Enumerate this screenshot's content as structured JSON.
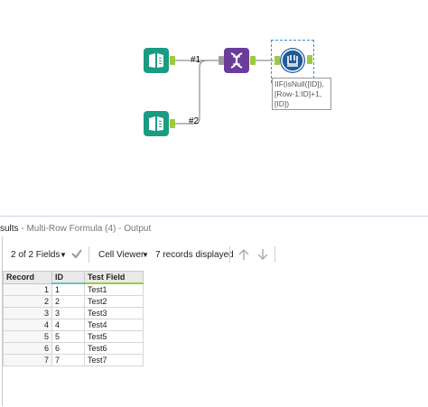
{
  "workflow": {
    "connection_labels": [
      "#1",
      "#2"
    ],
    "formula_annotation": [
      "IIF(isNull([ID]),",
      "[Row-1:ID]+1,",
      "[ID])"
    ]
  },
  "results": {
    "title_prefix": "sults",
    "title_suffix": "- Multi-Row Formula (4) - Output",
    "fields_label": "2 of 2 Fields",
    "cell_viewer_label": "Cell Viewer",
    "records_label": "7 records displayed",
    "columns": [
      "Record",
      "ID",
      "Test Field"
    ],
    "rows": [
      {
        "record": "1",
        "id": "1",
        "test_field": "Test1"
      },
      {
        "record": "2",
        "id": "2",
        "test_field": "Test2"
      },
      {
        "record": "3",
        "id": "3",
        "test_field": "Test3"
      },
      {
        "record": "4",
        "id": "4",
        "test_field": "Test4"
      },
      {
        "record": "5",
        "id": "5",
        "test_field": "Test5"
      },
      {
        "record": "6",
        "id": "6",
        "test_field": "Test6"
      },
      {
        "record": "7",
        "id": "7",
        "test_field": "Test7"
      }
    ]
  },
  "colors": {
    "input_tool": "#1a9c82",
    "join_tool": "#6a3d9a",
    "multi_row_formula_tool": "#1f5b99",
    "anchor": "#9ccc3c",
    "selection": "#3a8fd9"
  }
}
